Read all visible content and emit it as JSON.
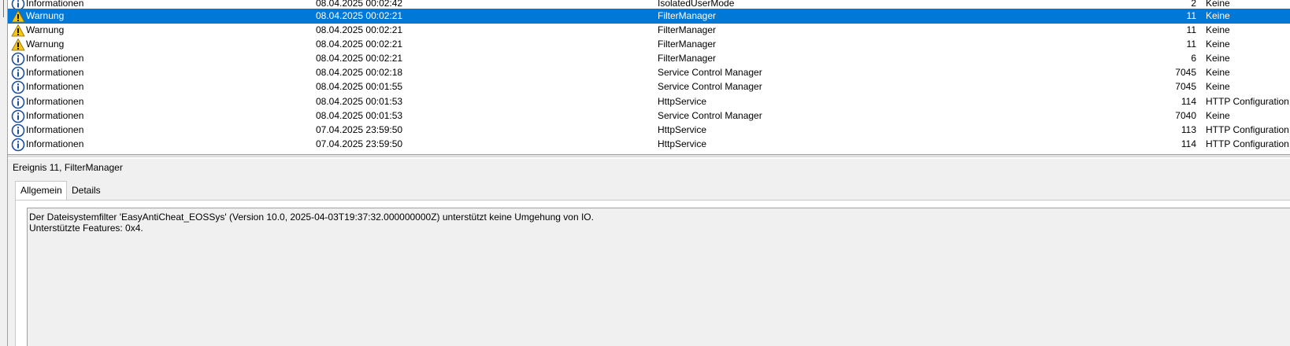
{
  "events": [
    {
      "level": "Informationen",
      "icon": "info-icon",
      "date": "08.04.2025 00:02:42",
      "source": "IsolatedUserMode",
      "id": "2",
      "category": "Keine",
      "selected": false
    },
    {
      "level": "Warnung",
      "icon": "warning-icon",
      "date": "08.04.2025 00:02:21",
      "source": "FilterManager",
      "id": "11",
      "category": "Keine",
      "selected": true
    },
    {
      "level": "Warnung",
      "icon": "warning-icon",
      "date": "08.04.2025 00:02:21",
      "source": "FilterManager",
      "id": "11",
      "category": "Keine",
      "selected": false
    },
    {
      "level": "Warnung",
      "icon": "warning-icon",
      "date": "08.04.2025 00:02:21",
      "source": "FilterManager",
      "id": "11",
      "category": "Keine",
      "selected": false
    },
    {
      "level": "Informationen",
      "icon": "info-icon",
      "date": "08.04.2025 00:02:21",
      "source": "FilterManager",
      "id": "6",
      "category": "Keine",
      "selected": false
    },
    {
      "level": "Informationen",
      "icon": "info-icon",
      "date": "08.04.2025 00:02:18",
      "source": "Service Control Manager",
      "id": "7045",
      "category": "Keine",
      "selected": false
    },
    {
      "level": "Informationen",
      "icon": "info-icon",
      "date": "08.04.2025 00:01:55",
      "source": "Service Control Manager",
      "id": "7045",
      "category": "Keine",
      "selected": false
    },
    {
      "level": "Informationen",
      "icon": "info-icon",
      "date": "08.04.2025 00:01:53",
      "source": "HttpService",
      "id": "114",
      "category": "HTTP Configuration P",
      "selected": false
    },
    {
      "level": "Informationen",
      "icon": "info-icon",
      "date": "08.04.2025 00:01:53",
      "source": "Service Control Manager",
      "id": "7040",
      "category": "Keine",
      "selected": false
    },
    {
      "level": "Informationen",
      "icon": "info-icon",
      "date": "07.04.2025 23:59:50",
      "source": "HttpService",
      "id": "113",
      "category": "HTTP Configuration P",
      "selected": false
    },
    {
      "level": "Informationen",
      "icon": "info-icon",
      "date": "07.04.2025 23:59:50",
      "source": "HttpService",
      "id": "114",
      "category": "HTTP Configuration P",
      "selected": false
    }
  ],
  "details": {
    "header": "Ereignis 11, FilterManager",
    "tabs": {
      "general": "Allgemein",
      "details": "Details"
    },
    "message_lines": [
      "Der Dateisystemfilter 'EasyAntiCheat_EOSSys' (Version 10.0, 2025-04-03T19:37:32.000000000Z) unterstützt keine Umgehung von IO.",
      "Unterstützte Features: 0x4."
    ]
  },
  "colors": {
    "selection": "#0078d7",
    "info_icon": "#1c4f9c",
    "warning_icon": "#f5c518"
  }
}
